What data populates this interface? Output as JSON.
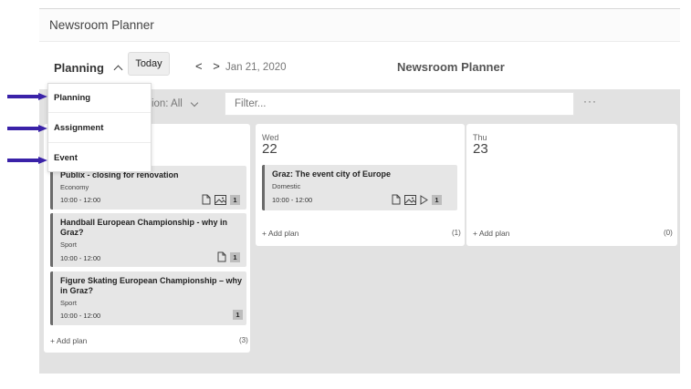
{
  "app": {
    "title": "Newsroom Planner"
  },
  "toolbar": {
    "view": "Planning",
    "today_label": "Today",
    "nav": "< >",
    "date": "Jan 21, 2020",
    "center_title": "Newsroom Planner"
  },
  "filterbar": {
    "section_label": "ction: All",
    "filter_placeholder": "Filter...",
    "more": "···"
  },
  "dropdown": {
    "items": [
      {
        "label": "Planning"
      },
      {
        "label": "Assignment"
      },
      {
        "label": "Event"
      }
    ]
  },
  "annotation": {
    "arrow_color": "#3a22a8"
  },
  "columns": [
    {
      "day": "",
      "date": "",
      "add_label": "+ Add plan",
      "count": "(3)",
      "cards": [
        {
          "title": "Publix - closing for renovation",
          "section": "Economy",
          "time": "10:00 - 12:00",
          "icons": [
            "document-icon",
            "image-icon"
          ],
          "badge": "1"
        },
        {
          "title": "Handball European Championship - why in Graz?",
          "section": "Sport",
          "time": "10:00 - 12:00",
          "icons": [
            "document-icon"
          ],
          "badge": "1"
        },
        {
          "title": "Figure Skating European Championship – why in Graz?",
          "section": "Sport",
          "time": "10:00 - 12:00",
          "icons": [],
          "badge": "1"
        }
      ]
    },
    {
      "day": "Wed",
      "date": "22",
      "add_label": "+ Add plan",
      "count": "(1)",
      "cards": [
        {
          "title": "Graz: The event city of Europe",
          "section": "Domestic",
          "time": "10:00 - 12:00",
          "icons": [
            "document-icon",
            "image-icon",
            "play-icon"
          ],
          "badge": "1"
        }
      ]
    },
    {
      "day": "Thu",
      "date": "23",
      "add_label": "+ Add plan",
      "count": "(0)",
      "cards": []
    }
  ]
}
